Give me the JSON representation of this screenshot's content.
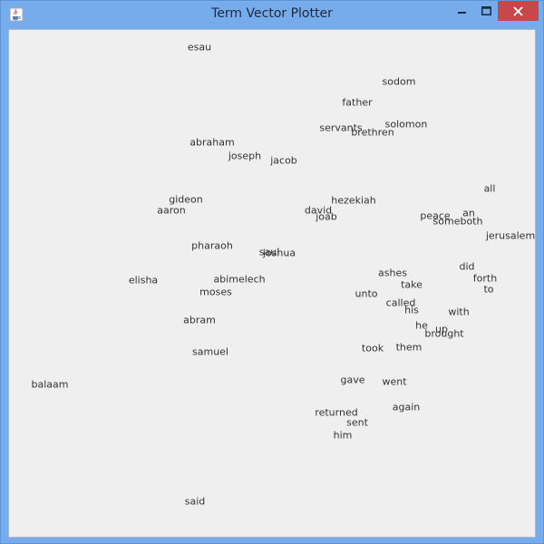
{
  "window": {
    "title": "Term Vector Plotter",
    "icons": {
      "app": "java-cup-icon",
      "minimize": "minimize-icon",
      "maximize": "maximize-icon",
      "close": "close-icon"
    },
    "colors": {
      "titlebar": "#76abec",
      "close_button": "#c7474a",
      "plot_background": "#efefef"
    }
  },
  "plot": {
    "terms": [
      {
        "word": "esau"
      },
      {
        "word": "sodom"
      },
      {
        "word": "father"
      },
      {
        "word": "servants"
      },
      {
        "word": "solomon"
      },
      {
        "word": "brethren"
      },
      {
        "word": "abraham"
      },
      {
        "word": "joseph"
      },
      {
        "word": "jacob"
      },
      {
        "word": "all"
      },
      {
        "word": "gideon"
      },
      {
        "word": "hezekiah"
      },
      {
        "word": "aaron"
      },
      {
        "word": "david"
      },
      {
        "word": "joab"
      },
      {
        "word": "peace"
      },
      {
        "word": "an"
      },
      {
        "word": "someboth"
      },
      {
        "word": "jerusalem"
      },
      {
        "word": "pharaoh"
      },
      {
        "word": "saul"
      },
      {
        "word": "joshua"
      },
      {
        "word": "did"
      },
      {
        "word": "ashes"
      },
      {
        "word": "elisha"
      },
      {
        "word": "abimelech"
      },
      {
        "word": "forth"
      },
      {
        "word": "take"
      },
      {
        "word": "to"
      },
      {
        "word": "moses"
      },
      {
        "word": "unto"
      },
      {
        "word": "called"
      },
      {
        "word": "his"
      },
      {
        "word": "with"
      },
      {
        "word": "abram"
      },
      {
        "word": "he"
      },
      {
        "word": "up"
      },
      {
        "word": "brought"
      },
      {
        "word": "samuel"
      },
      {
        "word": "took"
      },
      {
        "word": "them"
      },
      {
        "word": "balaam"
      },
      {
        "word": "gave"
      },
      {
        "word": "went"
      },
      {
        "word": "again"
      },
      {
        "word": "returned"
      },
      {
        "word": "sent"
      },
      {
        "word": "him"
      },
      {
        "word": "said"
      }
    ]
  }
}
